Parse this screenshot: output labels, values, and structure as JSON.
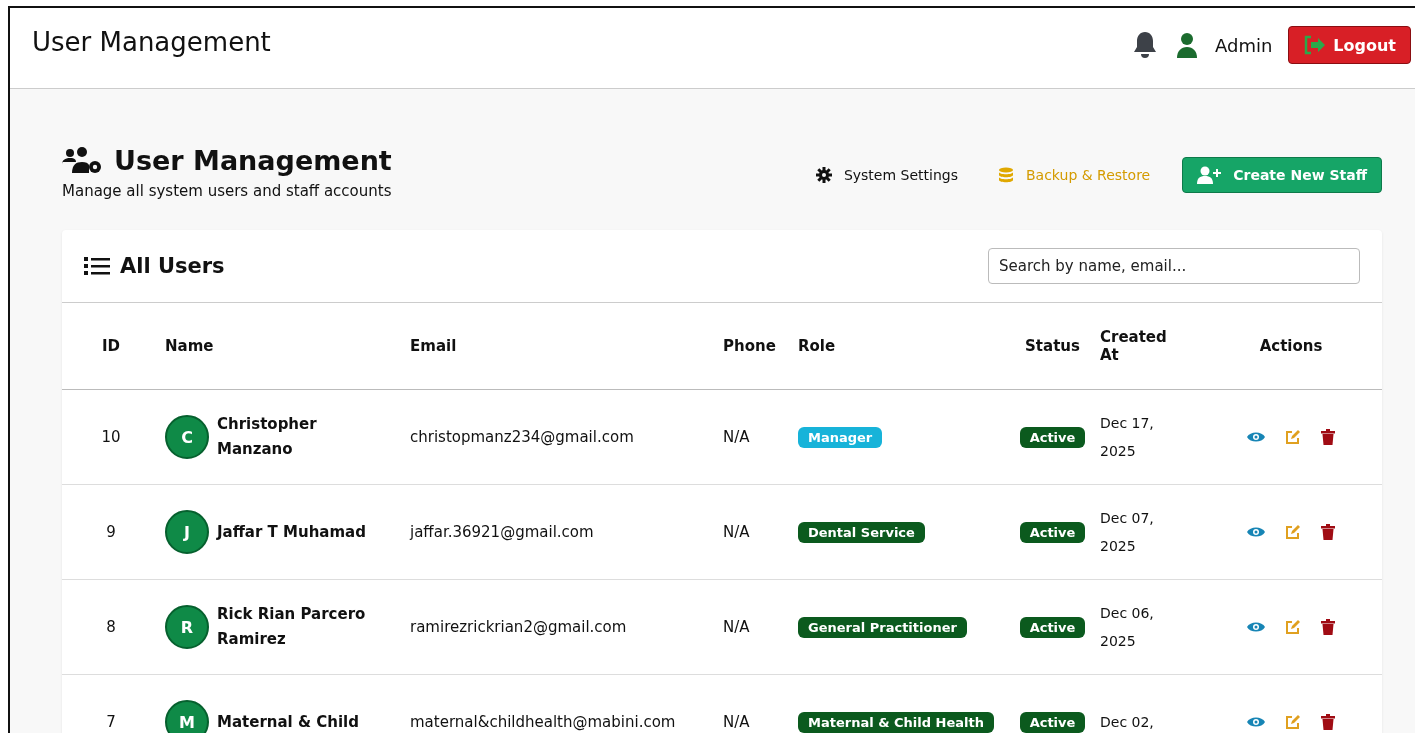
{
  "topbar": {
    "title": "User Management",
    "user": "Admin",
    "logout": "Logout"
  },
  "page": {
    "title": "User Management",
    "subtitle": "Manage all system users and staff accounts",
    "actions": [
      {
        "kind": "settings",
        "label": "System Settings"
      },
      {
        "kind": "backup",
        "label": "Backup & Restore"
      },
      {
        "kind": "create",
        "label": "Create New Staff"
      }
    ]
  },
  "card": {
    "title": "All Users",
    "search": {
      "placeholder": "Search by name, email..."
    }
  },
  "table": {
    "columns": [
      "ID",
      "Name",
      "Email",
      "Phone",
      "Role",
      "Status",
      "Created At",
      "Actions"
    ],
    "rows": [
      {
        "id": "10",
        "initial": "C",
        "name": "Christopher Manzano",
        "email": "christopmanz234@gmail.com",
        "phone": "N/A",
        "role": "Manager",
        "color": "#17b3d9",
        "status": "Active",
        "created": [
          "Dec 17,",
          "2025"
        ]
      },
      {
        "id": "9",
        "initial": "J",
        "name": "Jaffar T Muhamad",
        "email": "jaffar.36921@gmail.com",
        "phone": "N/A",
        "role": "Dental Service",
        "color": "#0b5a1e",
        "status": "Active",
        "created": [
          "Dec 07,",
          "2025"
        ]
      },
      {
        "id": "8",
        "initial": "R",
        "name": "Rick Rian Parcero Ramirez",
        "email": "ramirezrickrian2@gmail.com",
        "phone": "N/A",
        "role": "General Practitioner",
        "color": "#0b5a1e",
        "status": "Active",
        "created": [
          "Dec 06,",
          "2025"
        ]
      },
      {
        "id": "7",
        "initial": "M",
        "name": "Maternal & Child",
        "email": "maternal&childhealth@mabini.com",
        "phone": "N/A",
        "role": "Maternal & Child Health",
        "color": "#0b5a1e",
        "status": "Active",
        "created": [
          "Dec 02,"
        ]
      }
    ]
  }
}
